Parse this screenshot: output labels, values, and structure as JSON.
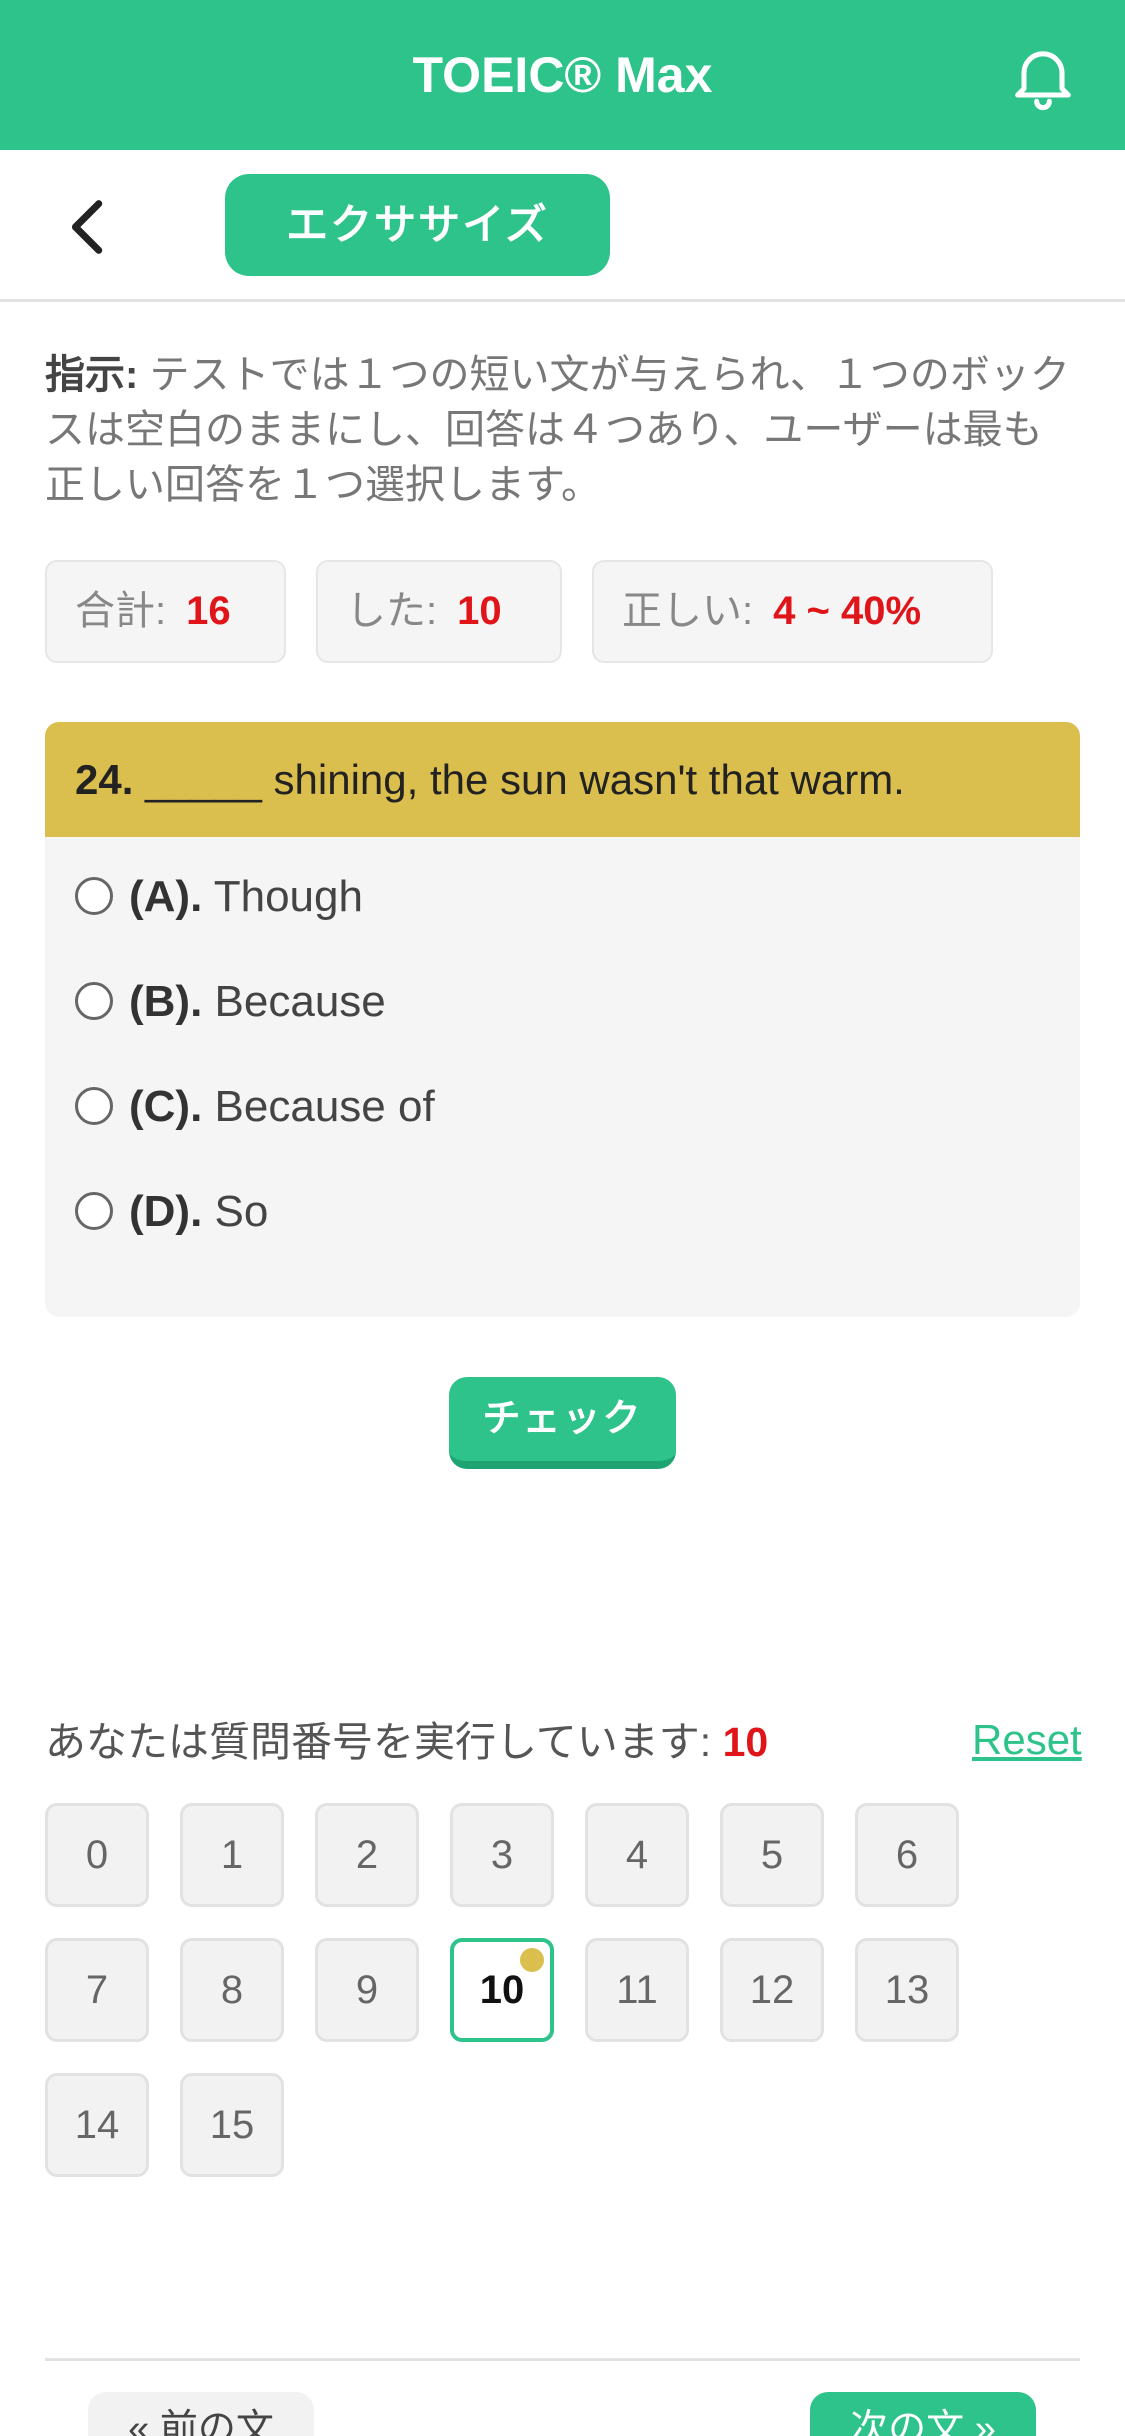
{
  "header": {
    "title": "TOEIC® Max",
    "bell_icon": "bell-icon",
    "back_icon": "chevron-left-icon",
    "tab_label": "エクササイズ"
  },
  "instruction": {
    "label": "指示:",
    "text": " テストでは１つの短い文が与えられ、１つのボックスは空白のままにし、回答は４つあり、ユーザーは最も正しい回答を１つ選択します。"
  },
  "stats": {
    "total_label": "合計:",
    "total_value": "16",
    "done_label": "した:",
    "done_value": "10",
    "correct_label": "正しい:",
    "correct_value": "4 ~ 40%"
  },
  "question": {
    "number": "24.",
    "text": " _____ shining, the sun wasn't that warm.",
    "options": [
      {
        "key": "(A).",
        "text": " Though"
      },
      {
        "key": "(B).",
        "text": " Because"
      },
      {
        "key": "(C).",
        "text": " Because of"
      },
      {
        "key": "(D).",
        "text": " So"
      }
    ]
  },
  "check_label": "チェック",
  "progress": {
    "label": "あなたは質問番号を実行しています:",
    "current": "10",
    "reset_label": "Reset",
    "numbers": [
      "0",
      "1",
      "2",
      "3",
      "4",
      "5",
      "6",
      "7",
      "8",
      "9",
      "10",
      "11",
      "12",
      "13",
      "14",
      "15"
    ]
  },
  "nav": {
    "prev_label": "« 前の文",
    "next_label": "次の文 »"
  },
  "colors": {
    "accent": "#2dc38a",
    "question_header": "#dbbf4e",
    "highlight": "#e0151a"
  }
}
